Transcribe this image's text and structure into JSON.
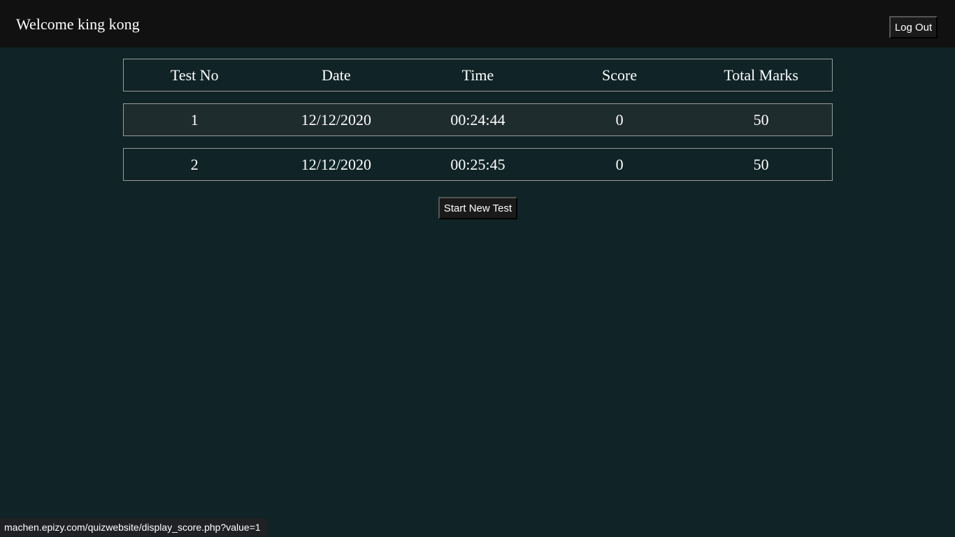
{
  "header": {
    "welcome_text": "Welcome king kong",
    "logout_label": "Log Out"
  },
  "table": {
    "columns": [
      "Test No",
      "Date",
      "Time",
      "Score",
      "Total Marks"
    ],
    "rows": [
      [
        "1",
        "12/12/2020",
        "00:24:44",
        "0",
        "50"
      ],
      [
        "2",
        "12/12/2020",
        "00:25:45",
        "0",
        "50"
      ]
    ]
  },
  "actions": {
    "start_new_test_label": "Start New Test"
  },
  "status_bar": {
    "url": "machen.epizy.com/quizwebsite/display_score.php?value=1"
  },
  "colors": {
    "page_background": "#102427",
    "topbar_background": "#121111",
    "highlight_row": "#1f2c2d"
  }
}
